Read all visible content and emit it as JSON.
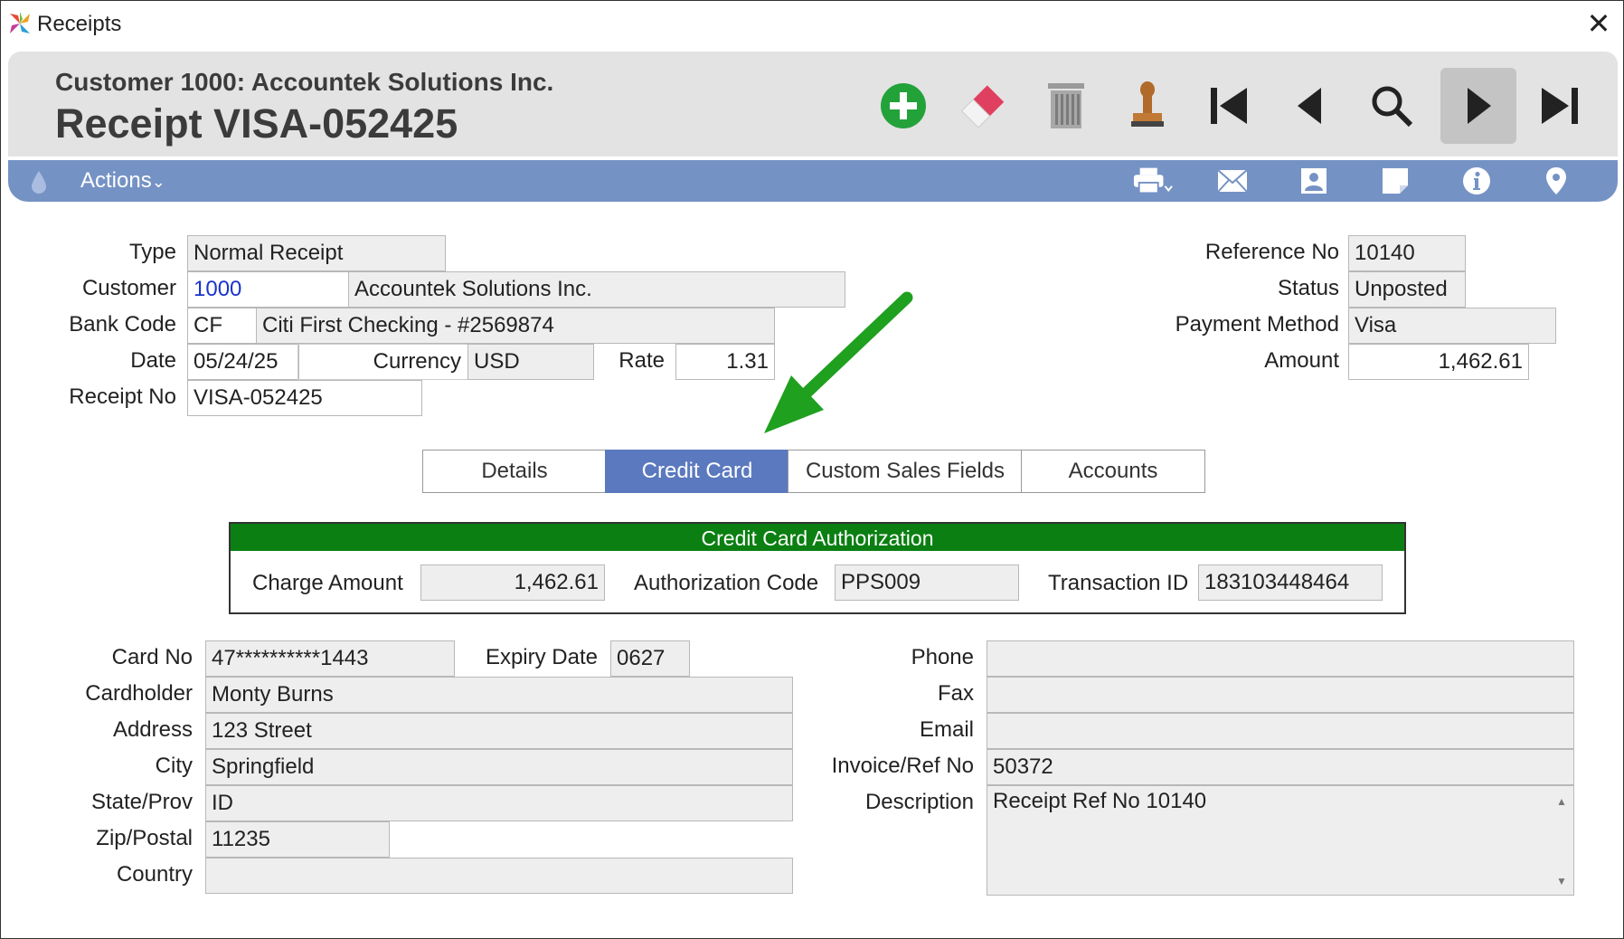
{
  "window": {
    "title": "Receipts",
    "close_glyph": "✕"
  },
  "header": {
    "subtitle": "Customer 1000: Accountek Solutions Inc.",
    "title": "Receipt VISA-052425"
  },
  "toolbar": {
    "icons": [
      "add-icon",
      "eraser-icon",
      "trash-icon",
      "stamp-icon",
      "first-record-icon",
      "previous-record-icon",
      "search-icon",
      "next-record-icon",
      "last-record-icon"
    ],
    "active": "next-record-icon"
  },
  "actions_bar": {
    "label": "Actions",
    "chevron": "⌄",
    "icons": [
      "drop-icon",
      "print-icon",
      "email-icon",
      "contact-icon",
      "note-icon",
      "info-icon",
      "location-pin-icon"
    ]
  },
  "form": {
    "type": {
      "label": "Type",
      "value": "Normal Receipt"
    },
    "customer": {
      "label": "Customer",
      "code": "1000",
      "name": "Accountek Solutions Inc."
    },
    "bank_code": {
      "label": "Bank Code",
      "code": "CF",
      "name": "Citi First Checking - #2569874"
    },
    "date": {
      "label": "Date",
      "value": "05/24/25"
    },
    "currency": {
      "label": "Currency",
      "value": "USD"
    },
    "rate": {
      "label": "Rate",
      "value": "1.31"
    },
    "receipt_no": {
      "label": "Receipt No",
      "value": "VISA-052425"
    },
    "reference_no": {
      "label": "Reference No",
      "value": "10140"
    },
    "status": {
      "label": "Status",
      "value": "Unposted"
    },
    "payment_method": {
      "label": "Payment Method",
      "value": "Visa"
    },
    "amount": {
      "label": "Amount",
      "value": "1,462.61"
    }
  },
  "tabs": [
    {
      "label": "Details"
    },
    {
      "label": "Credit Card"
    },
    {
      "label": "Custom Sales Fields"
    },
    {
      "label": "Accounts"
    }
  ],
  "active_tab": "Credit Card",
  "credit_card_auth": {
    "title": "Credit Card Authorization",
    "charge_amount": {
      "label": "Charge Amount",
      "value": "1,462.61"
    },
    "authorization_code": {
      "label": "Authorization Code",
      "value": "PPS009"
    },
    "transaction_id": {
      "label": "Transaction ID",
      "value": "183103448464"
    }
  },
  "card": {
    "card_no": {
      "label": "Card No",
      "value": "47**********1443"
    },
    "expiry_date": {
      "label": "Expiry Date",
      "value": "0627"
    },
    "cardholder": {
      "label": "Cardholder",
      "value": "Monty Burns"
    },
    "address": {
      "label": "Address",
      "value": "123 Street"
    },
    "city": {
      "label": "City",
      "value": "Springfield"
    },
    "state_prov": {
      "label": "State/Prov",
      "value": "ID"
    },
    "zip_postal": {
      "label": "Zip/Postal",
      "value": "11235"
    },
    "country": {
      "label": "Country",
      "value": ""
    },
    "phone": {
      "label": "Phone",
      "value": ""
    },
    "fax": {
      "label": "Fax",
      "value": ""
    },
    "email": {
      "label": "Email",
      "value": ""
    },
    "invoice_ref_no": {
      "label": "Invoice/Ref No",
      "value": "50372"
    },
    "description": {
      "label": "Description",
      "value": "Receipt Ref No 10140"
    }
  },
  "colors": {
    "accent_bar": "#7592c4",
    "active_tab": "#5b79bf",
    "auth_header": "#0b7f12",
    "annotation_arrow": "#1fa01f"
  }
}
